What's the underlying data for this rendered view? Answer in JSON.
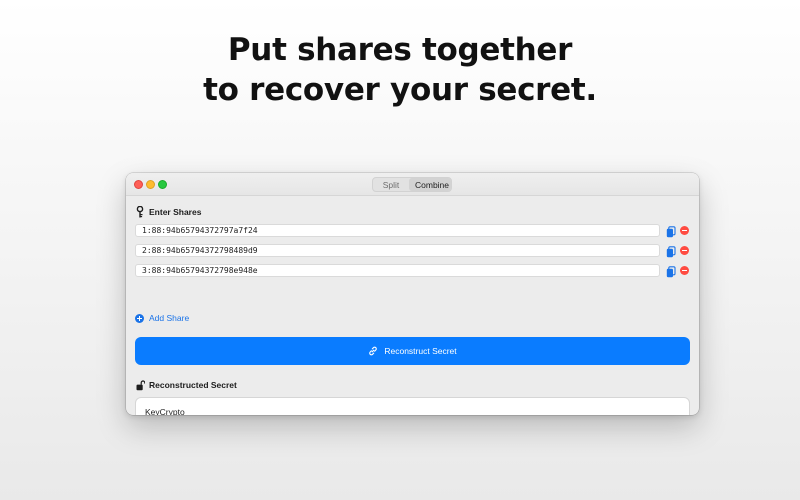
{
  "headline": {
    "line1": "Put shares together",
    "line2": "to recover your secret."
  },
  "window": {
    "tabs": [
      {
        "label": "Split",
        "active": false
      },
      {
        "label": "Combine",
        "active": true
      }
    ],
    "enter_shares": {
      "title": "Enter Shares",
      "icon": "key-icon",
      "shares": [
        "1:88:94b65794372797a7f24",
        "2:88:94b65794372798489d9",
        "3:88:94b65794372798e948e"
      ]
    },
    "add_share_label": "Add Share",
    "reconstruct_button_label": "Reconstruct Secret",
    "reconstructed": {
      "title": "Reconstructed Secret",
      "icon": "unlock-icon",
      "value": "KeyCrypto"
    }
  },
  "colors": {
    "accent": "#0a7cff",
    "remove": "#ff4b41",
    "copy": "#1a73e8"
  }
}
